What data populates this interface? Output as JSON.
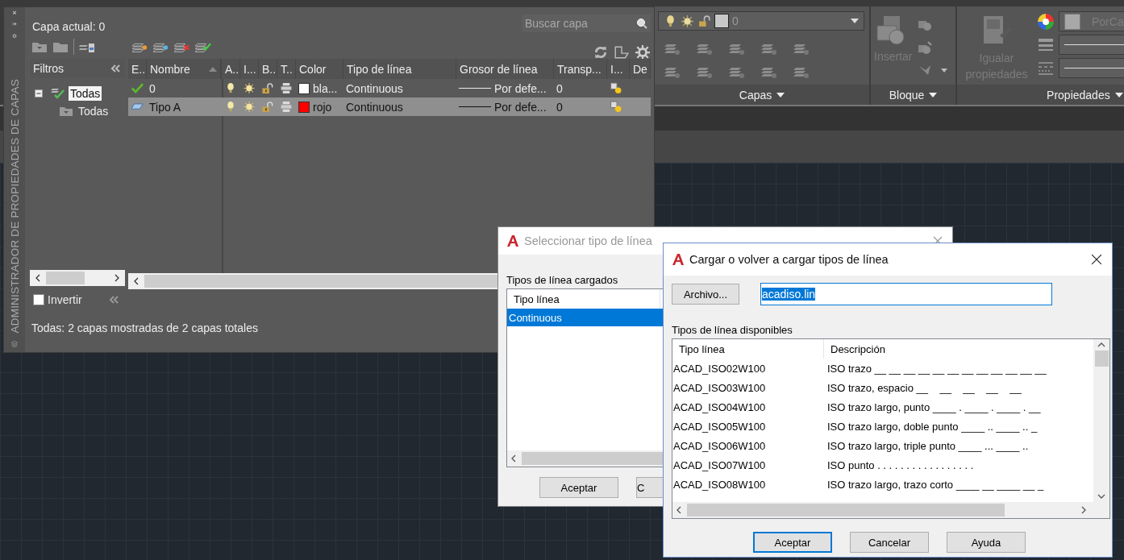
{
  "ribbon": {
    "layer_combo": "0",
    "insert": "Insertar",
    "match": "Igualar propiedades",
    "color_combo": "PorCa",
    "panels": [
      {
        "title": "Capas"
      },
      {
        "title": "Bloque"
      },
      {
        "title": "Propiedades"
      }
    ]
  },
  "palette": {
    "side_title": "ADMINISTRADOR DE PROPIEDADES DE CAPAS",
    "current_layer": "Capa actual: 0",
    "search": {
      "placeholder": "Buscar capa"
    },
    "filters": {
      "title": "Filtros",
      "tree": [
        {
          "label": "Todas",
          "selected": true,
          "expanded": true,
          "children": [
            {
              "label": "Todas",
              "selected": false
            }
          ]
        }
      ],
      "invert": {
        "label": "Invertir",
        "checked": false
      }
    },
    "columns": [
      "E..",
      "Nombre",
      "A..",
      "I...",
      "B..",
      "T..",
      "Color",
      "Tipo de línea",
      "Grosor de línea",
      "Transp...",
      "I...",
      "De"
    ],
    "layers": [
      {
        "current": true,
        "name": "0",
        "color_name": "bla...",
        "color": "#ffffff",
        "linetype": "Continuous",
        "lineweight": "Por defe...",
        "transparency": "0",
        "selected": false
      },
      {
        "current": false,
        "name": "Tipo A",
        "color_name": "rojo",
        "color": "#ff0000",
        "linetype": "Continuous",
        "lineweight": "Por defe...",
        "transparency": "0",
        "selected": true
      }
    ],
    "status": "Todas: 2 capas mostradas de 2 capas totales"
  },
  "select_dialog": {
    "title": "Seleccionar tipo de línea",
    "list_label": "Tipos de línea cargados",
    "column": "Tipo línea",
    "items": [
      {
        "name": "Continuous",
        "selected": true
      }
    ],
    "buttons": [
      {
        "label": "Aceptar",
        "default": false
      },
      {
        "label": "C",
        "default": false
      }
    ]
  },
  "load_dialog": {
    "title": "Cargar o volver a cargar tipos de línea",
    "file_button": "Archivo...",
    "file": "acadiso.lin",
    "list_label": "Tipos de línea disponibles",
    "columns": [
      "Tipo línea",
      "Descripción"
    ],
    "rows": [
      {
        "name": "ACAD_ISO02W100",
        "description": "ISO trazo __ __ __ __ __ __ __ __ __ __ __ __"
      },
      {
        "name": "ACAD_ISO03W100",
        "description": "ISO trazo, espacio __    __    __    __    __"
      },
      {
        "name": "ACAD_ISO04W100",
        "description": "ISO trazo largo, punto ____ . ____ . ____ . __"
      },
      {
        "name": "ACAD_ISO05W100",
        "description": "ISO trazo largo, doble punto ____ .. ____ .. _"
      },
      {
        "name": "ACAD_ISO06W100",
        "description": "ISO trazo largo, triple punto ____ ... ____ .."
      },
      {
        "name": "ACAD_ISO07W100",
        "description": "ISO punto . . . . . . . . . . . . . . . . ."
      },
      {
        "name": "ACAD_ISO08W100",
        "description": "ISO trazo largo, trazo corto ____ __ ____ __ _"
      }
    ],
    "buttons": [
      {
        "label": "Aceptar",
        "default": true
      },
      {
        "label": "Cancelar",
        "default": false
      },
      {
        "label": "Ayuda",
        "default": false
      }
    ]
  }
}
